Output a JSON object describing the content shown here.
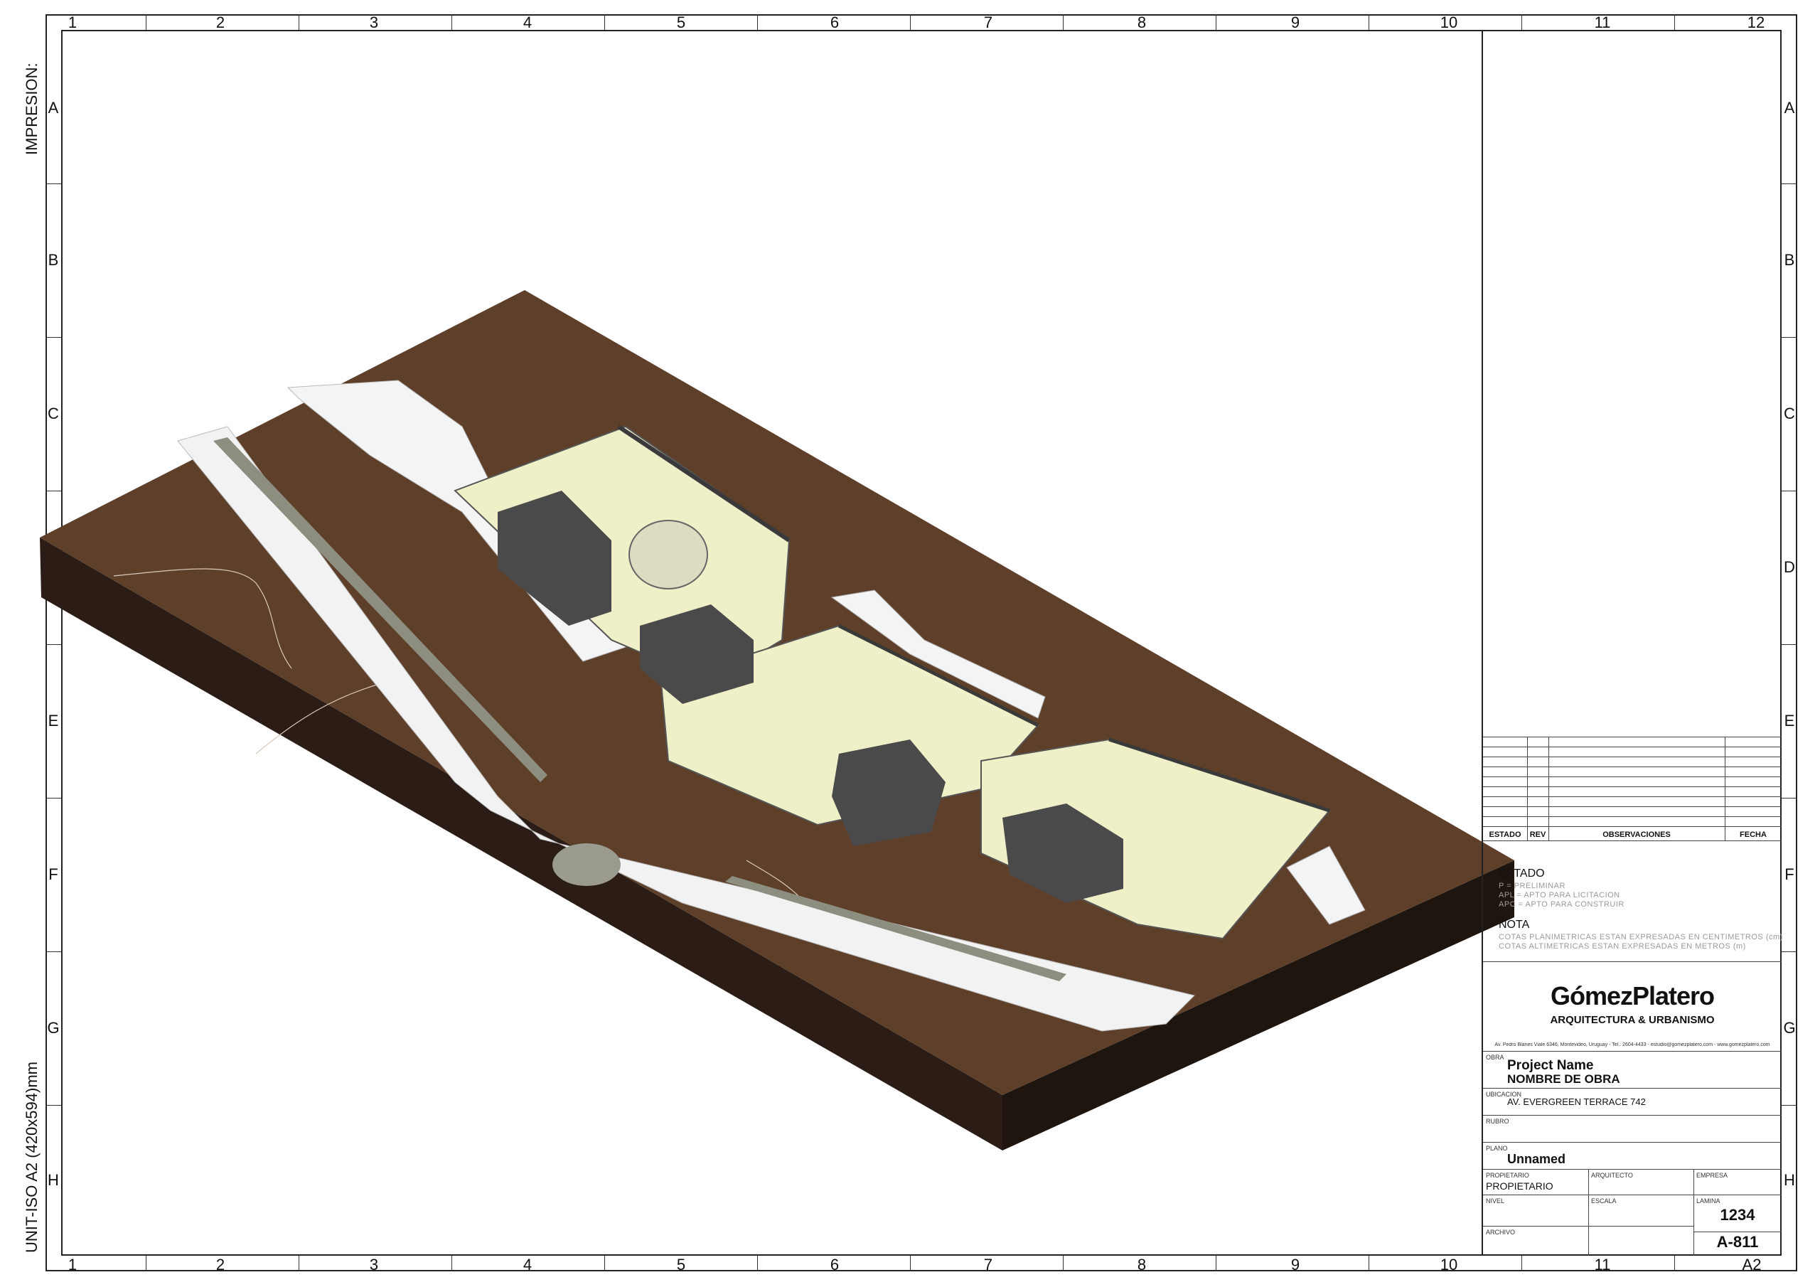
{
  "frame": {
    "columns": [
      "1",
      "2",
      "3",
      "4",
      "5",
      "6",
      "7",
      "8",
      "9",
      "10",
      "11",
      "12"
    ],
    "rows": [
      "A",
      "B",
      "C",
      "D",
      "E",
      "F",
      "G",
      "H"
    ],
    "left_top_label": "IMPRESION:",
    "left_bottom_label": "UNIT-ISO A2  (420x594)mm"
  },
  "revision_table": {
    "headers": [
      "ESTADO",
      "REV",
      "OBSERVACIONES",
      "FECHA"
    ]
  },
  "estado": {
    "title": "ESTADO",
    "lines": [
      "P  =  PRELIMINAR",
      "APL  =  APTO PARA LICITACION",
      "APC  =  APTO PARA CONSTRUIR"
    ]
  },
  "nota": {
    "title": "NOTA",
    "lines": [
      "COTAS PLANIMETRICAS ESTAN EXPRESADAS EN CENTIMETROS (cm)",
      "COTAS ALTIMETRICAS ESTAN EXPRESADAS EN METROS (m)"
    ]
  },
  "firm": {
    "name": "GómezPlatero",
    "tagline": "ARQUITECTURA & URBANISMO",
    "address": "Av. Pedro Blanes Viale 6346, Montevideo, Uruguay  -  Tel.: 2604-4433  -  estudio@gomezplatero.com  -  www.gomezplatero.com"
  },
  "title_block": {
    "obra_label": "OBRA",
    "project_name": "Project Name",
    "nombre_obra": "NOMBRE DE OBRA",
    "ubicacion_label": "UBICACION",
    "ubicacion": "AV.  EVERGREEN TERRACE 742",
    "rubro_label": "RUBRO",
    "plano_label": "PLANO",
    "plano": "Unnamed",
    "propietario_label": "PROPIETARIO",
    "propietario": "PROPIETARIO",
    "arquitecto_label": "ARQUITECTO",
    "empresa_label": "EMPRESA",
    "nivel_label": "NIVEL",
    "escala_label": "ESCALA",
    "lamina_label": "LAMINA",
    "lamina_number": "1234",
    "lamina_code": "A-811",
    "archivo_label": "ARCHIVO",
    "sheet_size": "A2"
  },
  "colors": {
    "terrain": "#5e3f2a",
    "terrain_side": "#2b1d15",
    "road": "#f2f2f2",
    "floor": "#efefc8",
    "walls": "#4a4a4a"
  }
}
